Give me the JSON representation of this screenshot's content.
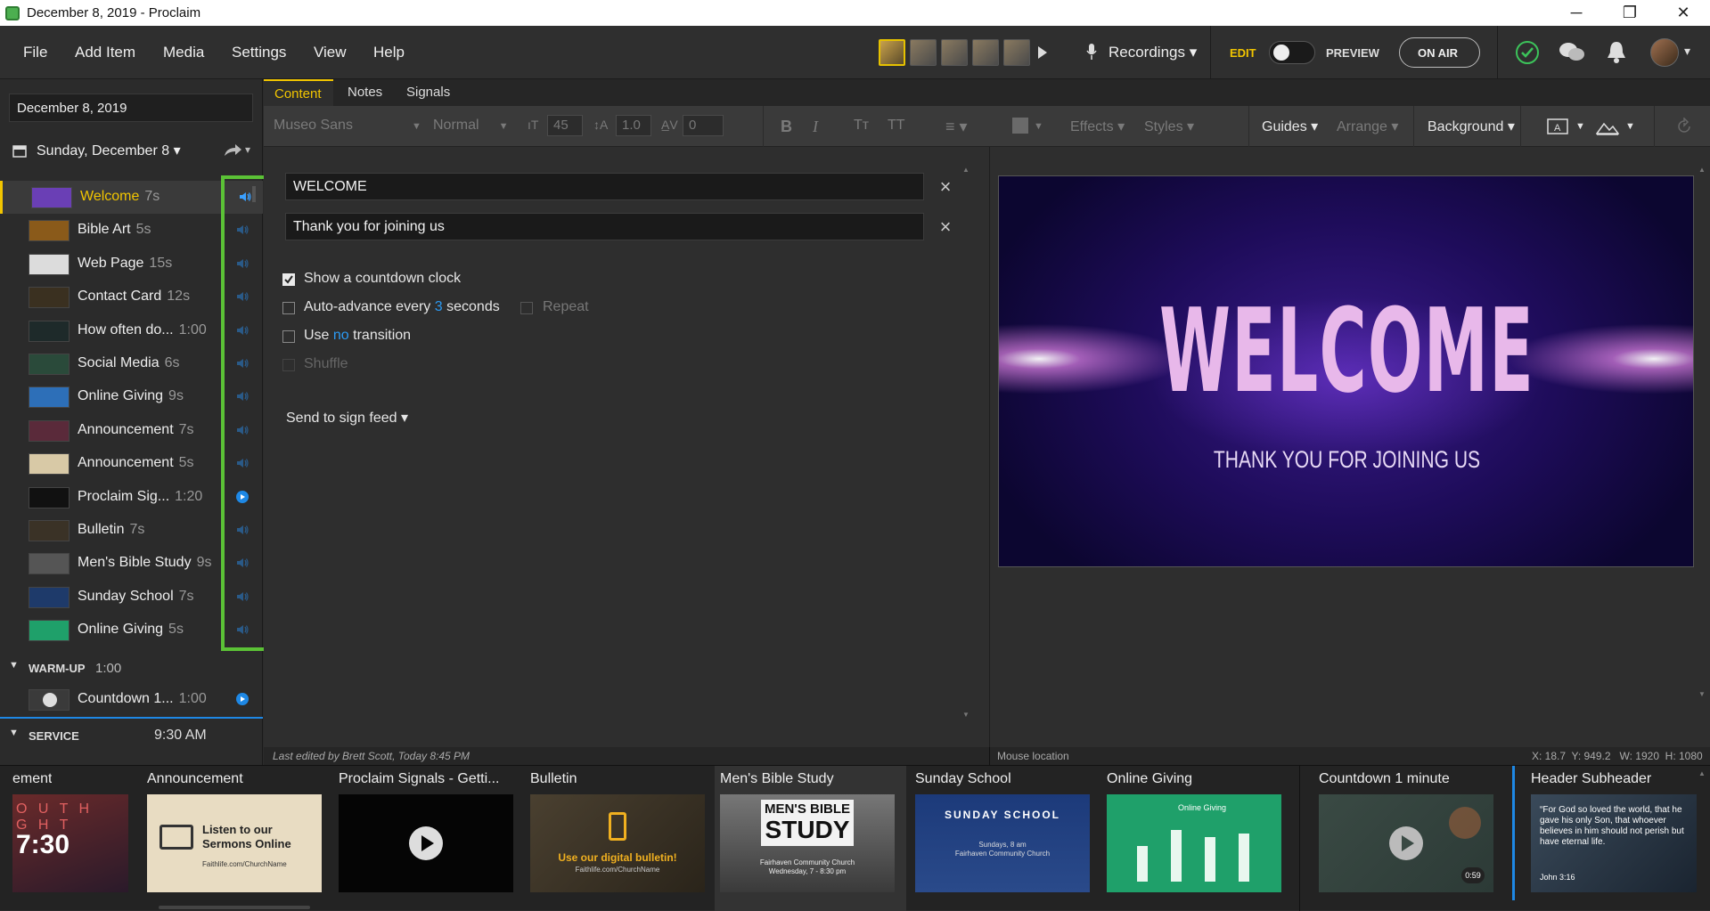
{
  "window": {
    "title": "December 8, 2019 - Proclaim",
    "min": "─",
    "max": "❐",
    "close": "✕"
  },
  "menu": {
    "file": "File",
    "add_item": "Add Item",
    "media": "Media",
    "settings": "Settings",
    "view": "View",
    "help": "Help"
  },
  "header": {
    "recordings": "Recordings",
    "edit": "EDIT",
    "preview": "PREVIEW",
    "on_air": "ON AIR"
  },
  "sidebar": {
    "date_field": "December 8, 2019",
    "date_select": "Sunday, December 8",
    "items": [
      {
        "label": "Welcome",
        "dur": "7s",
        "color": "#6a3fb5"
      },
      {
        "label": "Bible Art",
        "dur": "5s",
        "color": "#8a5a1a"
      },
      {
        "label": "Web Page",
        "dur": "15s",
        "color": "#dcdcdc"
      },
      {
        "label": "Contact Card",
        "dur": "12s",
        "color": "#3a3020"
      },
      {
        "label": "How often do...",
        "dur": "1:00",
        "color": "#1e2a2a"
      },
      {
        "label": "Social Media",
        "dur": "6s",
        "color": "#2a4a3a"
      },
      {
        "label": "Online Giving",
        "dur": "9s",
        "color": "#2d6fb8"
      },
      {
        "label": "Announcement",
        "dur": "7s",
        "color": "#5a2a3a"
      },
      {
        "label": "Announcement",
        "dur": "5s",
        "color": "#d8c9a6"
      },
      {
        "label": "Proclaim Sig...",
        "dur": "1:20",
        "color": "#111111"
      },
      {
        "label": "Bulletin",
        "dur": "7s",
        "color": "#3a3226"
      },
      {
        "label": "Men's Bible Study",
        "dur": "9s",
        "color": "#555555"
      },
      {
        "label": "Sunday School",
        "dur": "7s",
        "color": "#1e3a6a"
      },
      {
        "label": "Online Giving",
        "dur": "5s",
        "color": "#1fa06a"
      }
    ],
    "warmup": {
      "label": "WARM-UP",
      "dur": "1:00"
    },
    "countdown": {
      "label": "Countdown 1...",
      "dur": "1:00"
    },
    "service": {
      "label": "SERVICE",
      "time": "9:30 AM"
    }
  },
  "tabs": {
    "content": "Content",
    "notes": "Notes",
    "signals": "Signals"
  },
  "toolbar": {
    "font": "Museo Sans",
    "weight": "Normal",
    "size": "45",
    "line": "1.0",
    "spacing": "0",
    "bold": "B",
    "italic": "I",
    "tt1": "Tт",
    "tt2": "TT",
    "effects": "Effects",
    "styles": "Styles",
    "guides": "Guides",
    "arrange": "Arrange",
    "background": "Background"
  },
  "editor": {
    "field1": "WELCOME",
    "field2": "Thank you for joining us",
    "countdown": "Show a countdown clock",
    "auto_pre": "Auto-advance every",
    "auto_num": "3",
    "auto_post": "seconds",
    "repeat": "Repeat",
    "transition_pre": "Use",
    "transition_val": "no",
    "transition_post": "transition",
    "shuffle": "Shuffle",
    "sign_feed": "Send to sign feed"
  },
  "slide": {
    "title": "WELCOME",
    "subtitle": "THANK YOU FOR JOINING US"
  },
  "status": {
    "edited": "Last edited by Brett Scott, Today 8:45 PM",
    "mouse": "Mouse location",
    "coords": "X: 18.7  Y: 949.2   W: 1920  H: 1080"
  },
  "tray": [
    {
      "title": "ement",
      "t1": "O U T H",
      "t2": "G H T",
      "t3": "7:30"
    },
    {
      "title": "Announcement",
      "t1": "Listen to our",
      "t2": "Sermons Online",
      "t3": "Faithlife.com/ChurchName"
    },
    {
      "title": "Proclaim Signals - Getti..."
    },
    {
      "title": "Bulletin",
      "t1": "Use our digital bulletin!",
      "t2": "Faithlife.com/ChurchName"
    },
    {
      "title": "Men's Bible Study",
      "t1": "MEN'S BIBLE",
      "t2": "STUDY",
      "t3": "Fairhaven Community Church",
      "t4": "Wednesday, 7 - 8:30 pm"
    },
    {
      "title": "Sunday School",
      "t1": "SUNDAY SCHOOL",
      "t2": "Sundays, 8 am",
      "t3": "Fairhaven Community Church"
    },
    {
      "title": "Online Giving",
      "t1": "Online Giving"
    },
    {
      "title": "Countdown 1 minute",
      "t1": "0:59"
    },
    {
      "title": "Header Subheader",
      "t1": "“For God so loved the world, that he gave his only Son, that whoever believes in him should not perish but have eternal life.",
      "t2": "John 3:16"
    }
  ]
}
